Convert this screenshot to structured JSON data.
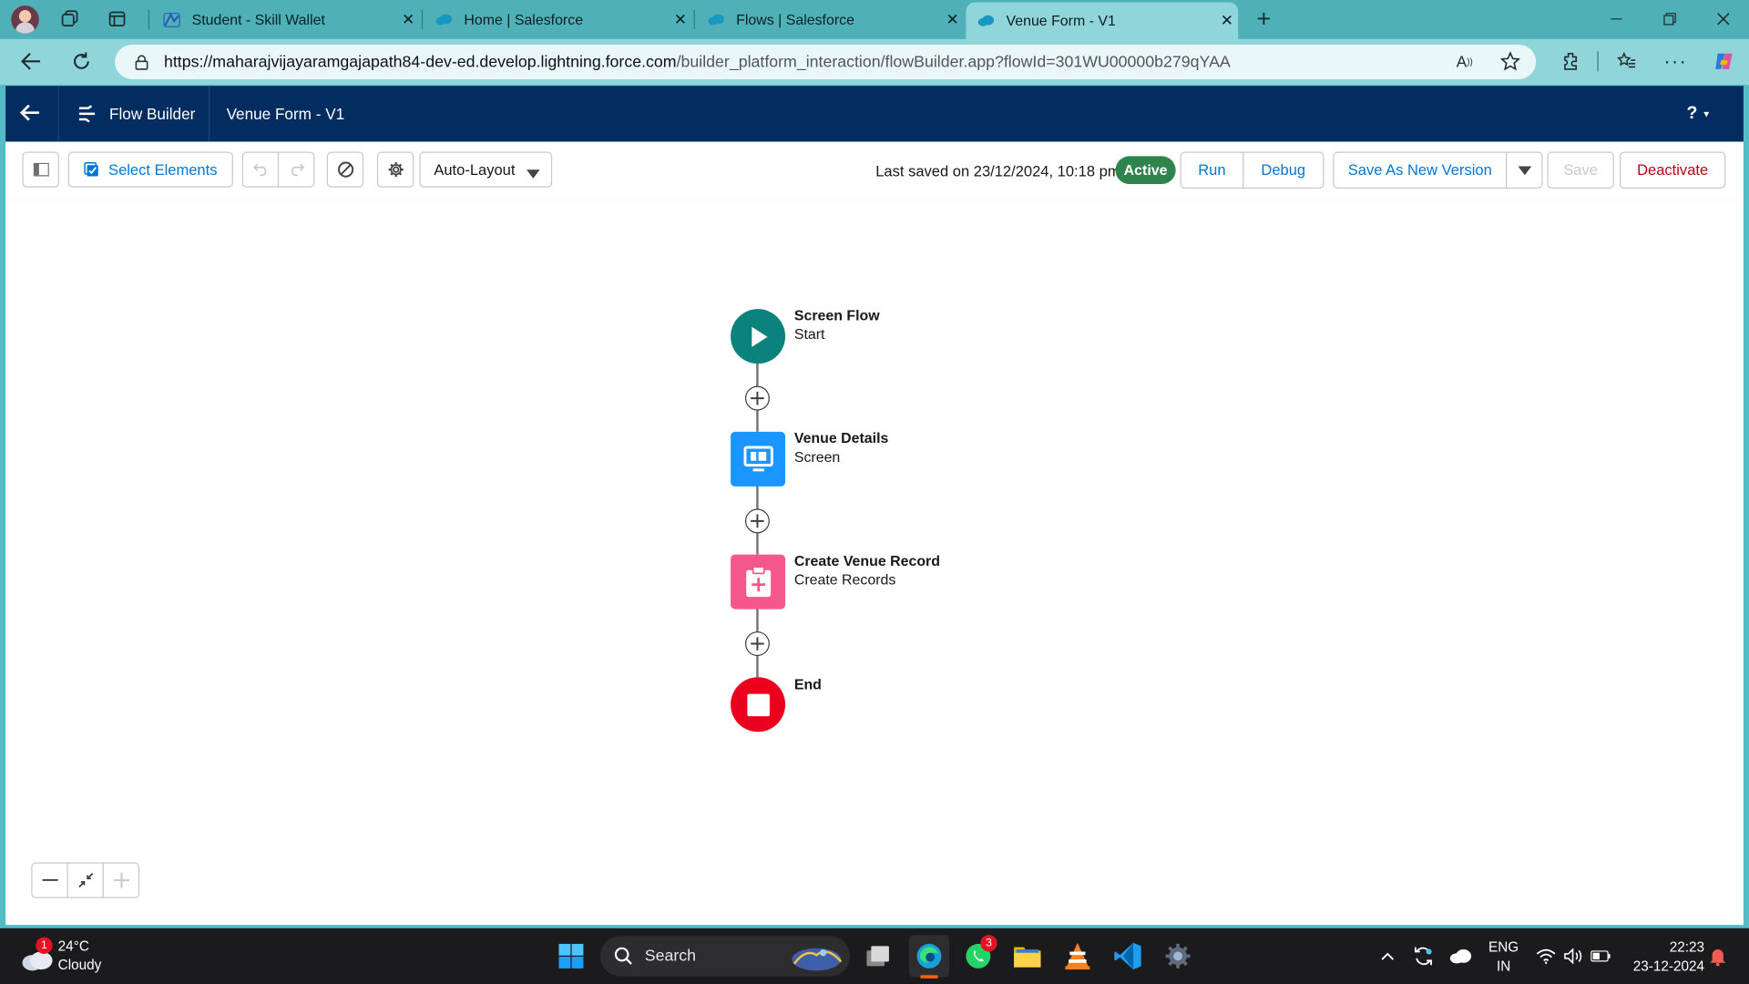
{
  "browser": {
    "tabs": [
      {
        "label": "Student - Skill Wallet",
        "icon": "skill-wallet-icon"
      },
      {
        "label": "Home | Salesforce",
        "icon": "salesforce-cloud-icon"
      },
      {
        "label": "Flows | Salesforce",
        "icon": "salesforce-cloud-icon"
      },
      {
        "label": "Venue Form - V1",
        "icon": "salesforce-cloud-icon",
        "active": true
      }
    ],
    "url_host": "https://maharajvijayaramgajapath84-dev-ed.develop.lightning.force.com",
    "url_path": "/builder_platform_interaction/flowBuilder.app?flowId=301WU00000b279qYAA"
  },
  "header": {
    "app_name": "Flow Builder",
    "flow_name": "Venue Form - V1",
    "help_label": "?"
  },
  "toolbar": {
    "select_elements": "Select Elements",
    "layout_select": "Auto-Layout",
    "last_saved": "Last saved on 23/12/2024, 10:18 pm",
    "status_badge": "Active",
    "run": "Run",
    "debug": "Debug",
    "save_as_new": "Save As New Version",
    "save": "Save",
    "deactivate": "Deactivate"
  },
  "flow": {
    "nodes": [
      {
        "title": "Screen Flow",
        "subtitle": "Start",
        "icon": "play-icon",
        "color": "#0b827c"
      },
      {
        "title": "Venue Details",
        "subtitle": "Screen",
        "icon": "screen-icon",
        "color": "#1b96ff"
      },
      {
        "title": "Create Venue Record",
        "subtitle": "Create Records",
        "icon": "create-record-icon",
        "color": "#f4578c"
      },
      {
        "title": "End",
        "subtitle": "",
        "icon": "stop-icon",
        "color": "#ea001e"
      }
    ]
  },
  "taskbar": {
    "weather_temp": "24°C",
    "weather_desc": "Cloudy",
    "weather_badge": "1",
    "search_label": "Search",
    "whatsapp_badge": "3",
    "lang_top": "ENG",
    "lang_bottom": "IN",
    "time": "22:23",
    "date": "23-12-2024"
  },
  "colors": {
    "sf_navy": "#032d60",
    "sf_blue": "#0176d3",
    "active_green": "#2e844a",
    "deactivate_red": "#ba0517"
  }
}
